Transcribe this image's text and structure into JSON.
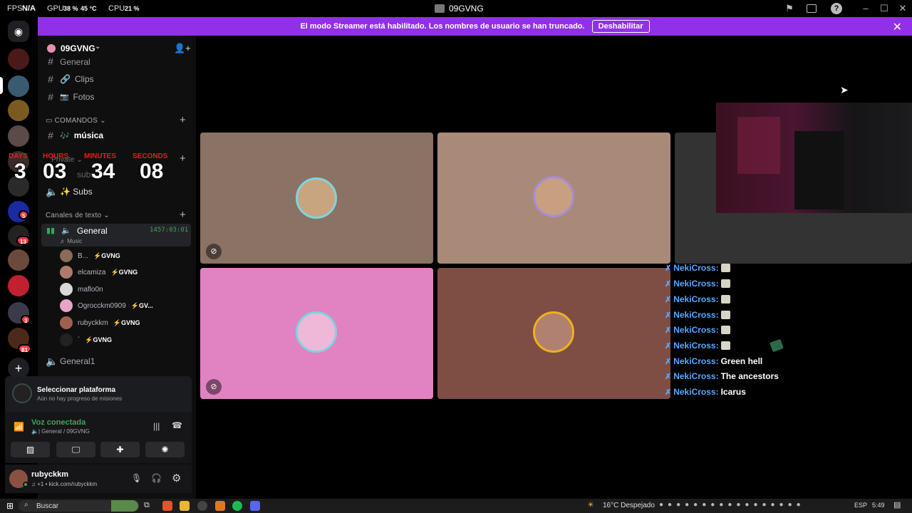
{
  "titlebar": {
    "fps_label": "FPS",
    "fps_value": "N/A",
    "gpu_label": "GPU",
    "gpu_value": "38 %",
    "gpu_temp": "45 °C",
    "cpu_label": "CPU",
    "cpu_value": "21 %",
    "app_title": "09GVNG"
  },
  "banner": {
    "message": "El modo Streamer está habilitado. Los nombres de usuario se han truncado.",
    "button": "Deshabilitar"
  },
  "rail": {
    "badges": [
      "5",
      "13",
      "3",
      "81"
    ]
  },
  "guild": {
    "name": "09GVNG"
  },
  "channels": {
    "partial_top": "General",
    "clips": "Clips",
    "fotos": "Fotos",
    "cat_comandos": "COMANDOS",
    "musica": "música",
    "cat_private": "Private",
    "subs_text": "subs",
    "subs_voice": "✨ Subs",
    "cat_texto": "Canales de texto",
    "general_voice": "General",
    "general_timer": "1457:03:01",
    "general_activity": "Music",
    "general1": "General1"
  },
  "timer": {
    "days_label": "DAYS",
    "hours_label": "HOURS",
    "minutes_label": "MINUTES",
    "seconds_label": "SECONDS",
    "days": "3",
    "hours": "03",
    "minutes": "34",
    "seconds": "08"
  },
  "members": [
    {
      "name": "B...",
      "tag": "⚡GVNG",
      "color": "#8a6a58"
    },
    {
      "name": "elcamiza",
      "tag": "⚡GVNG",
      "color": "#b07a6a"
    },
    {
      "name": "maflo0n",
      "tag": "",
      "color": "#d8d8d8"
    },
    {
      "name": "Ogrocckm0909",
      "tag": "⚡GV...",
      "color": "#e7a3c8"
    },
    {
      "name": "rubyckkm",
      "tag": "⚡GVNG",
      "color": "#a06050"
    },
    {
      "name": "`",
      "tag": "⚡GVNG",
      "color": "#222"
    }
  ],
  "quest": {
    "title": "Seleccionar plataforma",
    "subtitle": "Aún no hay progreso de misiones"
  },
  "voice": {
    "status": "Voz conectada",
    "channel": "General / 09GVNG"
  },
  "user": {
    "name": "rubyckkm",
    "status": "+1 • kick.com/rubyckkm"
  },
  "tiles_colors": {
    "t1": "#8a7264",
    "t2": "#a98a78",
    "t3": "#333333",
    "t4": "#e182c2",
    "t5": "#7e4e44"
  },
  "chat": [
    {
      "user": "NekiCross:",
      "msg": ""
    },
    {
      "user": "NekiCross:",
      "msg": ""
    },
    {
      "user": "NekiCross:",
      "msg": ""
    },
    {
      "user": "NekiCross:",
      "msg": ""
    },
    {
      "user": "NekiCross:",
      "msg": ""
    },
    {
      "user": "NekiCross:",
      "msg": ""
    },
    {
      "user": "NekiCross:",
      "msg": "Green hell"
    },
    {
      "user": "NekiCross:",
      "msg": "The ancestors"
    },
    {
      "user": "NekiCross:",
      "msg": "Icarus"
    }
  ],
  "taskbar": {
    "search": "Buscar",
    "weather": "16°C  Despejado",
    "lang": "ESP",
    "time": "5:49"
  }
}
